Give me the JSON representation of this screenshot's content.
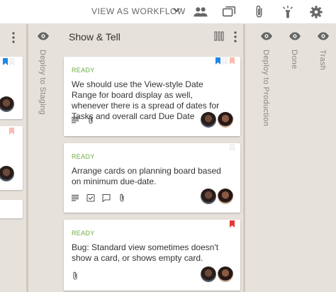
{
  "topbar": {
    "view_as_label": "VIEW AS WORKFLOW",
    "icons": [
      "people-icon",
      "cards-icon",
      "attachment-icon",
      "spotlight-icon",
      "settings-icon"
    ]
  },
  "columns": {
    "deploy_staging": {
      "label": "Deploy to Staging"
    },
    "show_tell": {
      "title": "Show & Tell"
    },
    "deploy_production": {
      "label": "Deploy to Production"
    },
    "done": {
      "label": "Done"
    },
    "trash": {
      "label": "Trash"
    }
  },
  "cards": [
    {
      "status": "READY",
      "title": "We should use the View-style Date Range for board display as well, whenever there is a spread of dates for Tasks and overall card Due Date",
      "icons": [
        "description-icon",
        "attachment-icon"
      ],
      "bookmarks": [
        "#1e88e5",
        "#f5f5f5",
        "#f8bbb0"
      ]
    },
    {
      "status": "READY",
      "title": "Arrange cards on planning board based on minimum due-date.",
      "icons": [
        "description-icon",
        "checklist-icon",
        "comment-icon",
        "attachment-icon"
      ],
      "bookmarks": [
        "#f5f5f5"
      ]
    },
    {
      "status": "READY",
      "title": "Bug: Standard view sometimes doesn't show a card, or shows empty card.",
      "icons": [
        "attachment-icon"
      ],
      "bookmarks": [
        "#e53935"
      ]
    }
  ],
  "colors": {
    "status_ready": "#6aae3e",
    "background": "#e6e1da",
    "accent_blue": "#1e88e5",
    "accent_red": "#e53935"
  }
}
